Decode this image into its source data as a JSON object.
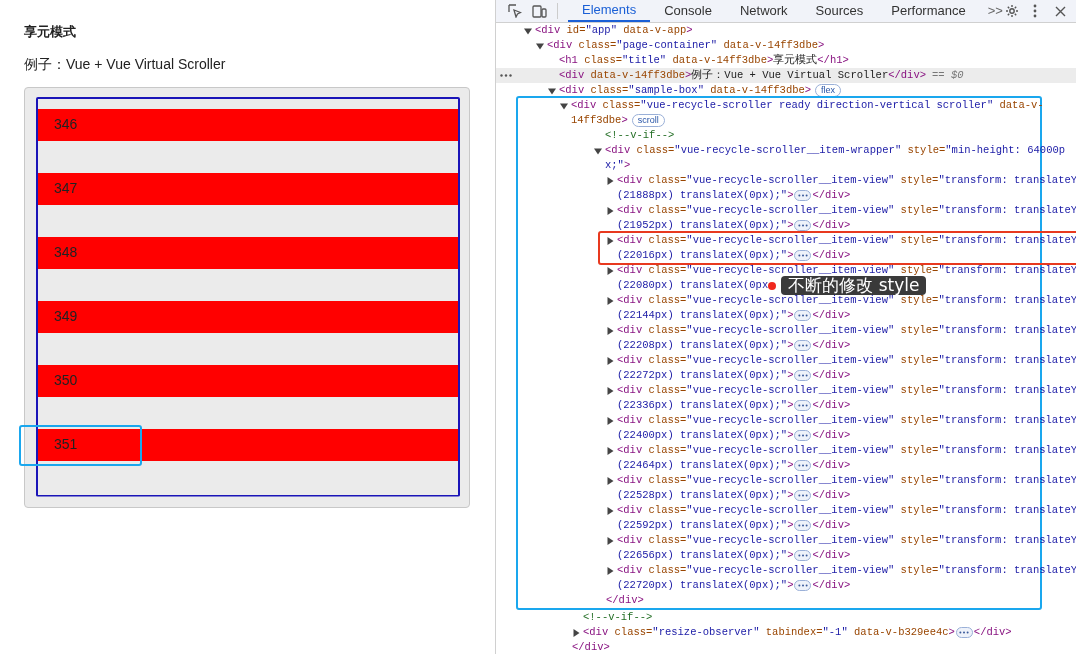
{
  "page": {
    "title": "享元模式",
    "subtitle": "例子：Vue + Vue Virtual Scroller",
    "rows": [
      {
        "label": "346",
        "highlighted": false
      },
      {
        "label": "347",
        "highlighted": false
      },
      {
        "label": "348",
        "highlighted": false
      },
      {
        "label": "349",
        "highlighted": false
      },
      {
        "label": "350",
        "highlighted": false
      },
      {
        "label": "351",
        "highlighted": true
      }
    ]
  },
  "devtools": {
    "tabs": [
      {
        "label": "Elements",
        "selected": true
      },
      {
        "label": "Console",
        "selected": false
      },
      {
        "label": "Network",
        "selected": false
      },
      {
        "label": "Sources",
        "selected": false
      },
      {
        "label": "Performance",
        "selected": false
      }
    ],
    "more_tabs": ">>",
    "tree": [
      {
        "kind": "element",
        "expanded": true,
        "selected": false,
        "lines": [
          "<div id=\"app\" data-v-app>"
        ],
        "children": [
          {
            "kind": "element",
            "expanded": true,
            "selected": false,
            "lines": [
              "<div class=\"page-container\" data-v-14ff3dbe>"
            ],
            "children": [
              {
                "kind": "leaf",
                "selected": false,
                "lines": [
                  "<h1 class=\"title\" data-v-14ff3dbe>享元模式</h1>"
                ]
              },
              {
                "kind": "leaf",
                "selected": true,
                "suffix": "== $0",
                "lines": [
                  "<div data-v-14ff3dbe>例子：Vue + Vue Virtual Scroller</div>"
                ]
              },
              {
                "kind": "element",
                "expanded": true,
                "selected": false,
                "badge": "flex",
                "lines": [
                  "<div class=\"sample-box\" data-v-14ff3dbe>"
                ],
                "children": [
                  {
                    "kind": "element",
                    "expanded": true,
                    "selected": false,
                    "badge": "scroll",
                    "color": "#1aa7ee",
                    "lines": [
                      "<div class=\"vue-recycle-scroller ready direction-vertical scroller\" data-v-",
                      "14ff3dbe>"
                    ],
                    "children": [
                      {
                        "kind": "comment",
                        "selected": false,
                        "lines": [
                          "<!--v-if-->"
                        ]
                      },
                      {
                        "kind": "element",
                        "expanded": true,
                        "selected": false,
                        "callout_end": true,
                        "lines": [
                          "<div class=\"vue-recycle-scroller__item-wrapper\" style=\"min-height: 64000p",
                          "x;\">"
                        ],
                        "close": "</div>",
                        "children": [
                          {
                            "kind": "element",
                            "expanded": false,
                            "selected": false,
                            "lines": [
                              "<div class=\"vue-recycle-scroller__item-view\" style=\"transform: translateY",
                              "(21888px) translateX(0px);\">"
                            ],
                            "close": "</div>"
                          },
                          {
                            "kind": "element",
                            "expanded": false,
                            "selected": false,
                            "lines": [
                              "<div class=\"vue-recycle-scroller__item-view\" style=\"transform: translateY",
                              "(21952px) translateX(0px);\">"
                            ],
                            "close": "</div>"
                          },
                          {
                            "kind": "element",
                            "expanded": false,
                            "selected": false,
                            "color": "#e8391f",
                            "lines": [
                              "<div class=\"vue-recycle-scroller__item-view\" style=\"transform: translateY",
                              "(22016px) translateX(0px);\">"
                            ],
                            "close": "</div>"
                          },
                          {
                            "kind": "element",
                            "expanded": false,
                            "selected": false,
                            "tooltip": "不断的修改 style",
                            "lines": [
                              "<div class=\"vue-recycle-scroller__item-view\" style=\"transform: translateY",
                              "(22080px) translateX(0px"
                            ]
                          },
                          {
                            "kind": "element",
                            "expanded": false,
                            "selected": false,
                            "lines": [
                              "<div class=\"vue-recycle-scroller__item-view\" style=\"transform: translateY",
                              "(22144px) translateX(0px);\">"
                            ],
                            "close": "</div>"
                          },
                          {
                            "kind": "element",
                            "expanded": false,
                            "selected": false,
                            "lines": [
                              "<div class=\"vue-recycle-scroller__item-view\" style=\"transform: translateY",
                              "(22208px) translateX(0px);\">"
                            ],
                            "close": "</div>"
                          },
                          {
                            "kind": "element",
                            "expanded": false,
                            "selected": false,
                            "lines": [
                              "<div class=\"vue-recycle-scroller__item-view\" style=\"transform: translateY",
                              "(22272px) translateX(0px);\">"
                            ],
                            "close": "</div>"
                          },
                          {
                            "kind": "element",
                            "expanded": false,
                            "selected": false,
                            "lines": [
                              "<div class=\"vue-recycle-scroller__item-view\" style=\"transform: translateY",
                              "(22336px) translateX(0px);\">"
                            ],
                            "close": "</div>"
                          },
                          {
                            "kind": "element",
                            "expanded": false,
                            "selected": false,
                            "lines": [
                              "<div class=\"vue-recycle-scroller__item-view\" style=\"transform: translateY",
                              "(22400px) translateX(0px);\">"
                            ],
                            "close": "</div>"
                          },
                          {
                            "kind": "element",
                            "expanded": false,
                            "selected": false,
                            "lines": [
                              "<div class=\"vue-recycle-scroller__item-view\" style=\"transform: translateY",
                              "(22464px) translateX(0px);\">"
                            ],
                            "close": "</div>"
                          },
                          {
                            "kind": "element",
                            "expanded": false,
                            "selected": false,
                            "lines": [
                              "<div class=\"vue-recycle-scroller__item-view\" style=\"transform: translateY",
                              "(22528px) translateX(0px);\">"
                            ],
                            "close": "</div>"
                          },
                          {
                            "kind": "element",
                            "expanded": false,
                            "selected": false,
                            "lines": [
                              "<div class=\"vue-recycle-scroller__item-view\" style=\"transform: translateY",
                              "(22592px) translateX(0px);\">"
                            ],
                            "close": "</div>"
                          },
                          {
                            "kind": "element",
                            "expanded": false,
                            "selected": false,
                            "lines": [
                              "<div class=\"vue-recycle-scroller__item-view\" style=\"transform: translateY",
                              "(22656px) translateX(0px);\">"
                            ],
                            "close": "</div>"
                          },
                          {
                            "kind": "element",
                            "expanded": false,
                            "selected": false,
                            "lines": [
                              "<div class=\"vue-recycle-scroller__item-view\" style=\"transform: translateY",
                              "(22720px) translateX(0px);\">"
                            ],
                            "close": "</div>"
                          }
                        ]
                      },
                      {
                        "kind": "comment",
                        "selected": false,
                        "lines": [
                          "<!--v-if-->"
                        ]
                      },
                      {
                        "kind": "element",
                        "expanded": false,
                        "selected": false,
                        "lines": [
                          "<div class=\"resize-observer\" tabindex=\"-1\" data-v-b329ee4c>"
                        ],
                        "close": "</div>"
                      }
                    ],
                    "close": "</div>"
                  }
                ]
              }
            ]
          }
        ]
      }
    ]
  }
}
